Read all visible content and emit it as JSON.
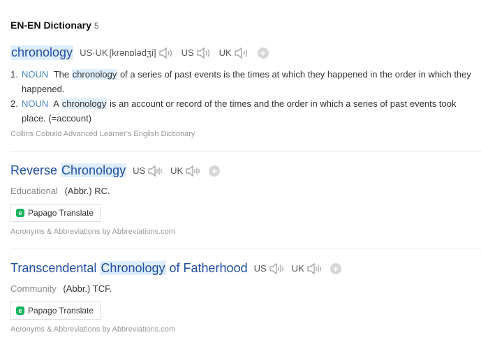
{
  "section": {
    "title": "EN-EN Dictionary",
    "count": "5"
  },
  "entry1": {
    "headword": "chronology",
    "us_uk_label": "US·UK",
    "phonetic": "[krənɒlədʒi]",
    "us_label": "US",
    "uk_label": "UK",
    "meanings": [
      {
        "num": "1.",
        "pos": "NOUN",
        "pre": "The",
        "hl": "chronology",
        "post": "of a series of past events is the times at which they happened in the order in which they happened."
      },
      {
        "num": "2.",
        "pos": "NOUN",
        "pre": "A",
        "hl": "chronology",
        "post": "is an account or record of the times and the order in which a series of past events took place. (=account)"
      }
    ],
    "source": "Collins Cobuild Advanced Learner's English Dictionary"
  },
  "entry2": {
    "hw_pre": "Reverse",
    "hw_hl": "Chronology",
    "hw_post": "",
    "us_label": "US",
    "uk_label": "UK",
    "category": "Educational",
    "abbr": "(Abbr.) RC.",
    "translate_label": "Papago Translate",
    "source": "Acronyms & Abbreviations by Abbreviations.com"
  },
  "entry3": {
    "hw_pre": "Transcendental",
    "hw_hl": "Chronology",
    "hw_post": "of Fatherhood",
    "us_label": "US",
    "uk_label": "UK",
    "category": "Community",
    "abbr": "(Abbr.) TCF.",
    "translate_label": "Papago Translate",
    "source": "Acronyms & Abbreviations by Abbreviations.com"
  },
  "icons": {
    "speaker": "speaker-icon",
    "add": "plus-icon",
    "papago": "papago-logo-icon"
  }
}
